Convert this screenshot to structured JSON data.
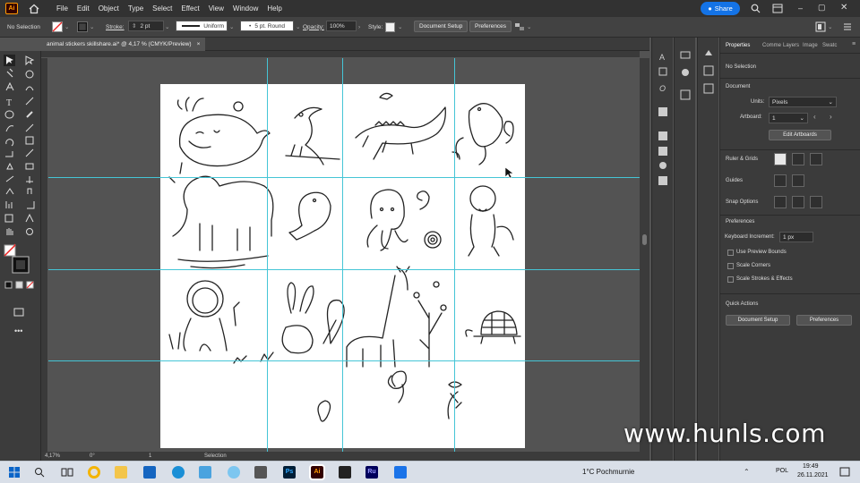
{
  "app": {
    "logo": "Ai"
  },
  "menu": [
    "File",
    "Edit",
    "Object",
    "Type",
    "Select",
    "Effect",
    "View",
    "Window",
    "Help"
  ],
  "share_label": "Share",
  "control_bar": {
    "selection_state": "No Selection",
    "stroke_label": "Stroke:",
    "stroke_weight": "2 pt",
    "profile": "Uniform",
    "brush": "5 pt. Round",
    "opacity_label": "Opacity:",
    "opacity_value": "100%",
    "style_label": "Style:",
    "document_setup": "Document Setup",
    "preferences": "Preferences"
  },
  "document_tab": {
    "title": "animal stickers skillshare.ai* @ 4,17 % (CMYK/Preview)",
    "close": "×"
  },
  "status": {
    "zoom": "4,17%",
    "rotation": "0°",
    "artboard": "1",
    "tool": "Selection"
  },
  "properties_panel": {
    "tabs": [
      "Properties",
      "Comme",
      "Layers",
      "Image",
      "Swatc"
    ],
    "selection": "No Selection",
    "document_header": "Document",
    "units_label": "Units:",
    "units_value": "Pixels",
    "artboard_label": "Artboard:",
    "artboard_value": "1",
    "edit_artboards": "Edit Artboards",
    "ruler_grids": "Ruler & Grids",
    "guides": "Guides",
    "snap_options": "Snap Options",
    "preferences_header": "Preferences",
    "keyboard_increment_label": "Keyboard Increment:",
    "keyboard_increment_value": "1 px",
    "checkboxes": [
      "Use Preview Bounds",
      "Scale Corners",
      "Scale Strokes & Effects"
    ],
    "quick_actions": "Quick Actions",
    "document_setup_btn": "Document Setup",
    "preferences_btn": "Preferences"
  },
  "taskbar": {
    "weather": "1°C  Pochmurnie",
    "language": "POL",
    "time": "19:49",
    "date": "26.11.2021"
  },
  "watermark": "www.hunls.com",
  "colors": {
    "guide": "#45c5d6",
    "ai_orange": "#ff9a00",
    "share_blue": "#1473e6"
  }
}
